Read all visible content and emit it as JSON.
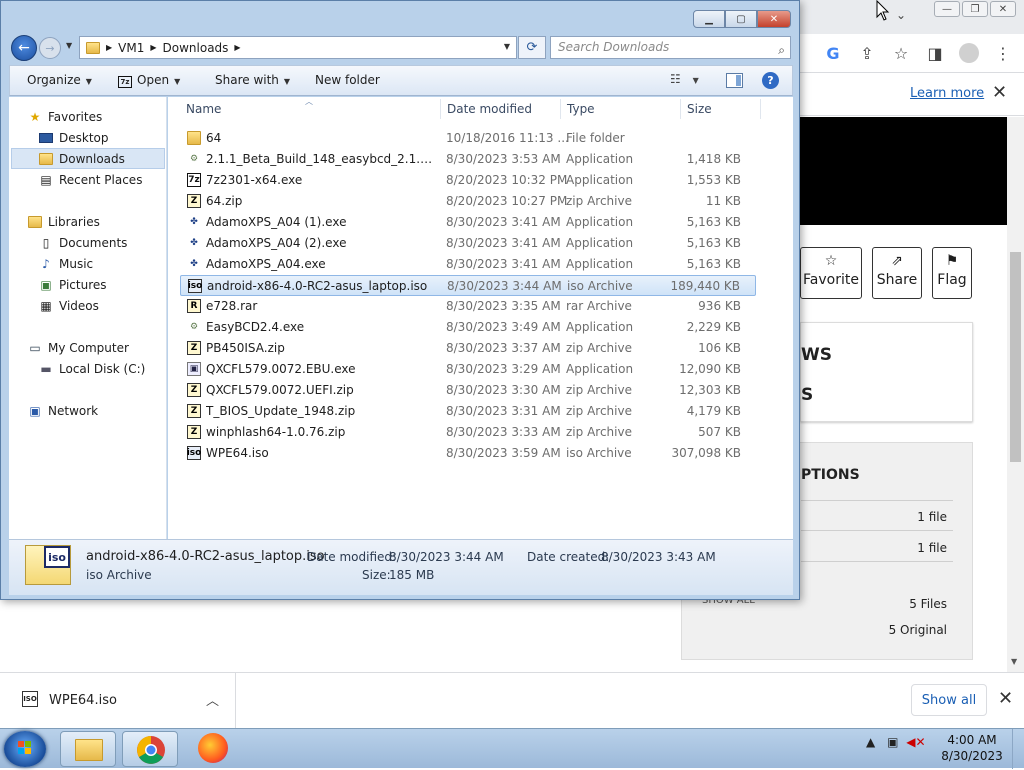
{
  "chrome": {
    "toolbar_icons": [
      "google-icon",
      "share-icon",
      "star-icon",
      "sidepanel-icon",
      "profile-icon",
      "menu-icon"
    ],
    "learn_more": "Learn more",
    "actions": [
      {
        "label": "Favorite",
        "icon": "star-outline-icon"
      },
      {
        "label": "Share",
        "icon": "share-icon"
      },
      {
        "label": "Flag",
        "icon": "flag-icon"
      }
    ],
    "panel1": {
      "line1": "WS",
      "line2": "S"
    },
    "panel2": {
      "header": "PTIONS",
      "rows": [
        {
          "value": "1 file"
        },
        {
          "value": "1 file"
        }
      ],
      "show_all_cut": "SHOW ALL",
      "files_count": "5 Files",
      "original_count": "5 Original"
    },
    "download": {
      "name": "WPE64.iso",
      "show_all": "Show all"
    }
  },
  "explorer": {
    "breadcrumb": [
      "VM1",
      "Downloads"
    ],
    "search_placeholder": "Search Downloads",
    "commands": {
      "organize": "Organize",
      "open": "Open",
      "share_with": "Share with",
      "new_folder": "New folder"
    },
    "nav": {
      "favorites": "Favorites",
      "desktop": "Desktop",
      "downloads": "Downloads",
      "recent": "Recent Places",
      "libraries": "Libraries",
      "documents": "Documents",
      "music": "Music",
      "pictures": "Pictures",
      "videos": "Videos",
      "computer": "My Computer",
      "local_disk": "Local Disk (C:)",
      "network": "Network"
    },
    "columns": {
      "name": "Name",
      "date": "Date modified",
      "type": "Type",
      "size": "Size"
    },
    "files": [
      {
        "name": "64",
        "date": "10/18/2016 11:13 ...",
        "type": "File folder",
        "size": "",
        "icon": "folder-icon"
      },
      {
        "name": "2.1.1_Beta_Build_148_easybcd_2.1.1_beta_...",
        "date": "8/30/2023 3:53 AM",
        "type": "Application",
        "size": "1,418 KB",
        "icon": "gear-app-icon"
      },
      {
        "name": "7z2301-x64.exe",
        "date": "8/20/2023 10:32 PM",
        "type": "Application",
        "size": "1,553 KB",
        "icon": "7zip-icon"
      },
      {
        "name": "64.zip",
        "date": "8/20/2023 10:27 PM",
        "type": "zip Archive",
        "size": "11 KB",
        "icon": "zip-icon"
      },
      {
        "name": "AdamoXPS_A04 (1).exe",
        "date": "8/30/2023 3:41 AM",
        "type": "Application",
        "size": "5,163 KB",
        "icon": "dell-app-icon"
      },
      {
        "name": "AdamoXPS_A04 (2).exe",
        "date": "8/30/2023 3:41 AM",
        "type": "Application",
        "size": "5,163 KB",
        "icon": "dell-app-icon"
      },
      {
        "name": "AdamoXPS_A04.exe",
        "date": "8/30/2023 3:41 AM",
        "type": "Application",
        "size": "5,163 KB",
        "icon": "dell-app-icon"
      },
      {
        "name": "android-x86-4.0-RC2-asus_laptop.iso",
        "date": "8/30/2023 3:44 AM",
        "type": "iso Archive",
        "size": "189,440 KB",
        "icon": "iso-icon",
        "selected": true
      },
      {
        "name": "e728.rar",
        "date": "8/30/2023 3:35 AM",
        "type": "rar Archive",
        "size": "936 KB",
        "icon": "rar-icon"
      },
      {
        "name": "EasyBCD2.4.exe",
        "date": "8/30/2023 3:49 AM",
        "type": "Application",
        "size": "2,229 KB",
        "icon": "gear-app-icon"
      },
      {
        "name": "PB450ISA.zip",
        "date": "8/30/2023 3:37 AM",
        "type": "zip Archive",
        "size": "106 KB",
        "icon": "zip-icon"
      },
      {
        "name": "QXCFL579.0072.EBU.exe",
        "date": "8/30/2023 3:29 AM",
        "type": "Application",
        "size": "12,090 KB",
        "icon": "exe-icon"
      },
      {
        "name": "QXCFL579.0072.UEFI.zip",
        "date": "8/30/2023 3:30 AM",
        "type": "zip Archive",
        "size": "12,303 KB",
        "icon": "zip-icon"
      },
      {
        "name": "T_BIOS_Update_1948.zip",
        "date": "8/30/2023 3:31 AM",
        "type": "zip Archive",
        "size": "4,179 KB",
        "icon": "zip-icon"
      },
      {
        "name": "winphlash64-1.0.76.zip",
        "date": "8/30/2023 3:33 AM",
        "type": "zip Archive",
        "size": "507 KB",
        "icon": "zip-icon"
      },
      {
        "name": "WPE64.iso",
        "date": "8/30/2023 3:59 AM",
        "type": "iso Archive",
        "size": "307,098 KB",
        "icon": "iso-icon"
      }
    ],
    "details": {
      "name": "android-x86-4.0-RC2-asus_laptop.iso",
      "type": "iso Archive",
      "modified_label": "Date modified:",
      "modified": "8/30/2023 3:44 AM",
      "created_label": "Date created:",
      "created": "8/30/2023 3:43 AM",
      "size_label": "Size:",
      "size": "185 MB"
    }
  },
  "taskbar": {
    "time": "4:00 AM",
    "date": "8/30/2023"
  }
}
